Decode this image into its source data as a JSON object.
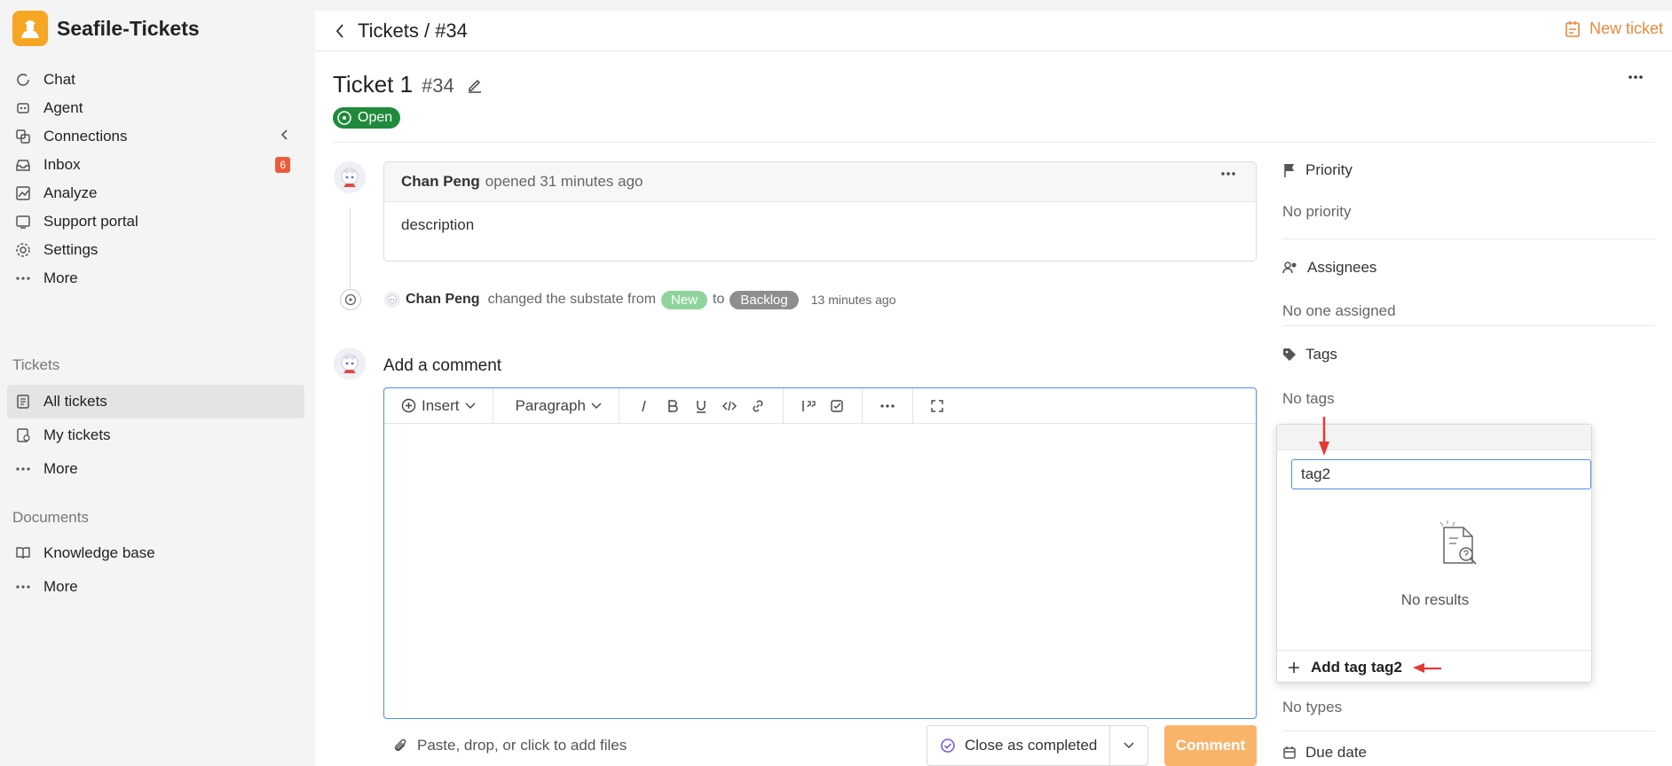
{
  "app": {
    "name": "Seafile-Tickets"
  },
  "sidebar": {
    "items": [
      {
        "label": "Chat",
        "icon": "chat-icon"
      },
      {
        "label": "Agent",
        "icon": "agent-icon"
      },
      {
        "label": "Connections",
        "icon": "connections-icon"
      },
      {
        "label": "Inbox",
        "icon": "inbox-icon",
        "badge": "6"
      },
      {
        "label": "Analyze",
        "icon": "analyze-icon"
      },
      {
        "label": "Support portal",
        "icon": "portal-icon"
      },
      {
        "label": "Settings",
        "icon": "gear-icon"
      },
      {
        "label": "More",
        "icon": "more-icon"
      }
    ],
    "tickets_section": "Tickets",
    "tickets_items": [
      {
        "label": "All tickets",
        "icon": "tickets-icon"
      },
      {
        "label": "My tickets",
        "icon": "my-tickets-icon"
      },
      {
        "label": "More",
        "icon": "more-icon"
      }
    ],
    "documents_section": "Documents",
    "documents_items": [
      {
        "label": "Knowledge base",
        "icon": "book-icon"
      },
      {
        "label": "More",
        "icon": "more-icon"
      }
    ]
  },
  "header": {
    "breadcrumb": "Tickets / #34",
    "new_ticket": "New ticket"
  },
  "ticket": {
    "title": "Ticket 1",
    "number": "#34",
    "status": "Open"
  },
  "comment": {
    "author": "Chan Peng",
    "action": "opened 31 minutes ago",
    "body": "description"
  },
  "event": {
    "author": "Chan Peng",
    "text": "changed the substate from",
    "from": "New",
    "to_word": "to",
    "to": "Backlog",
    "time": "13 minutes ago"
  },
  "composer": {
    "label": "Add a comment",
    "insert": "Insert",
    "paragraph": "Paragraph",
    "attach_hint": "Paste, drop, or click to add files",
    "close_label": "Close as completed",
    "comment_label": "Comment"
  },
  "details": {
    "priority_title": "Priority",
    "priority_value": "No priority",
    "assignees_title": "Assignees",
    "assignees_value": "No one assigned",
    "tags_title": "Tags",
    "tags_value": "No tags",
    "types_value": "No types",
    "due_title": "Due date"
  },
  "tag_popup": {
    "query": "tag2",
    "empty_text": "No results",
    "add_label": "Add tag tag2"
  },
  "colors": {
    "brand": "#f5a623",
    "status_open": "#1f8a3b",
    "accent_blue": "#4d8ee8",
    "new_ticket": "#e8893a",
    "comment_button": "#f9b46a",
    "annotation_red": "#e53935"
  }
}
